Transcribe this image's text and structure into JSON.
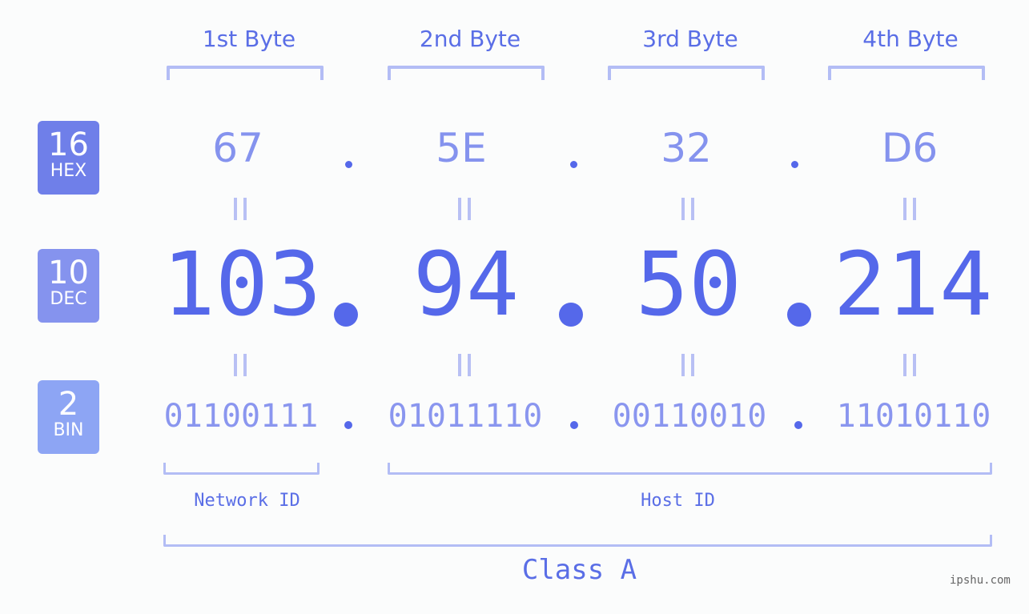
{
  "bytes": [
    {
      "label": "1st Byte",
      "hex": "67",
      "dec": "103",
      "bin": "01100111"
    },
    {
      "label": "2nd Byte",
      "hex": "5E",
      "dec": "94",
      "bin": "01011110"
    },
    {
      "label": "3rd Byte",
      "hex": "32",
      "dec": "50",
      "bin": "00110010"
    },
    {
      "label": "4th Byte",
      "hex": "D6",
      "dec": "214",
      "bin": "11010110"
    }
  ],
  "badges": {
    "hex": {
      "num": "16",
      "label": "HEX",
      "color": "#6f7fe9"
    },
    "dec": {
      "num": "10",
      "label": "DEC",
      "color": "#8593ee"
    },
    "bin": {
      "num": "2",
      "label": "BIN",
      "color": "#8da5f4"
    }
  },
  "separator": ".",
  "equals": "=",
  "parts": {
    "network": "Network ID",
    "host": "Host ID"
  },
  "ip_class": "Class A",
  "watermark": "ipshu.com",
  "colors": {
    "accent": "#5568ea",
    "light": "#b3bdf5",
    "hex_text": "#8593ee"
  }
}
